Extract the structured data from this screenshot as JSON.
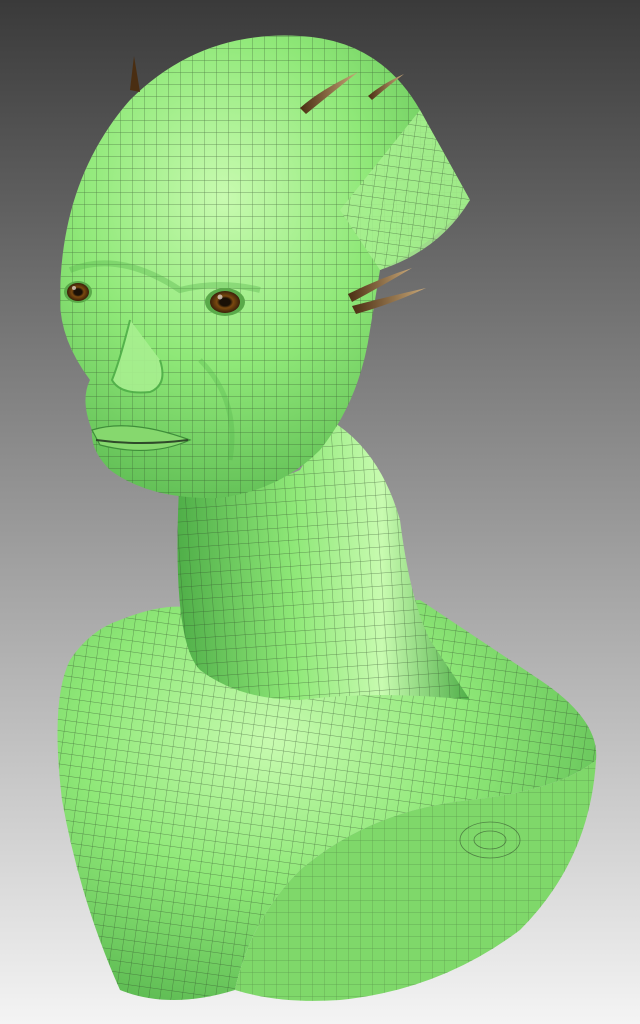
{
  "viewport": {
    "background_top": "#3a3a3a",
    "background_bottom": "#f4f4f4"
  },
  "model": {
    "skin_color": "#8fe878",
    "skin_shadow": "#4fae48",
    "skin_highlight": "#c8fbb0",
    "wire_color": "#2f4a2a",
    "eye_iris": "#7a4a10",
    "eye_pupil": "#1a1006",
    "spike_color": "#4a2e12",
    "spike_tip": "#c9a878"
  }
}
